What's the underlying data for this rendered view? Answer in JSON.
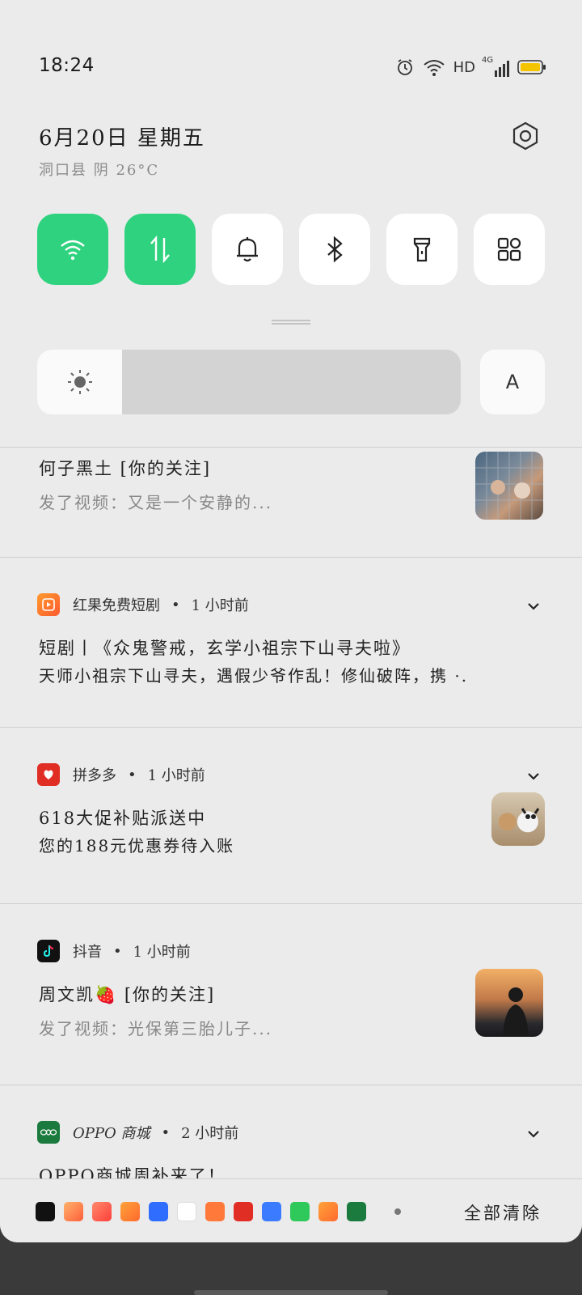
{
  "status_bar": {
    "time": "18:24",
    "hd_label": "HD",
    "network_label": "4G",
    "icons": [
      "alarm-icon",
      "wifi-icon",
      "signal-icon",
      "battery-icon"
    ]
  },
  "header": {
    "date": "6月20日  星期五",
    "weather": "洞口县 阴 26°C"
  },
  "quick_tiles": [
    {
      "name": "wifi",
      "icon": "wifi-icon",
      "active": true
    },
    {
      "name": "mobile-data",
      "icon": "data-arrows-icon",
      "active": true
    },
    {
      "name": "sound",
      "icon": "bell-icon",
      "active": false
    },
    {
      "name": "bluetooth",
      "icon": "bluetooth-icon",
      "active": false
    },
    {
      "name": "flashlight",
      "icon": "flashlight-icon",
      "active": false
    },
    {
      "name": "edit-tiles",
      "icon": "grid-icon",
      "active": false
    }
  ],
  "brightness": {
    "level": 0.2,
    "auto_label": "A"
  },
  "notifications": [
    {
      "title": "何子黑土 [你的关注]",
      "body": "发了视频：又是一个安静的..."
    },
    {
      "app": "红果免费短剧",
      "time": "1 小时前",
      "title": "短剧丨《众鬼警戒，玄学小祖宗下山寻夫啦》",
      "body": "天师小祖宗下山寻夫，遇假少爷作乱！修仙破阵，携 ·."
    },
    {
      "app": "拼多多",
      "time": "1 小时前",
      "title": "618大促补贴派送中",
      "body": "您的188元优惠券待入账"
    },
    {
      "app": "抖音",
      "time": "1 小时前",
      "title": "周文凯🍓 [你的关注]",
      "body": "发了视频：光保第三胎儿子..."
    },
    {
      "app": "OPPO 商城",
      "time": "2 小时前",
      "title": "OPPO商城周补来了！"
    }
  ],
  "bottom_bar": {
    "clear_all": "全部清除",
    "app_icons": [
      "douyin",
      "game-a",
      "game-b",
      "hongguo",
      "baidu",
      "map",
      "kids",
      "pinduoduo",
      "baidu-2",
      "green-app",
      "hongguo-2",
      "oppo-store"
    ]
  },
  "colors": {
    "accent_green": "#2fd27e",
    "shade_bg": "#ebebeb"
  }
}
